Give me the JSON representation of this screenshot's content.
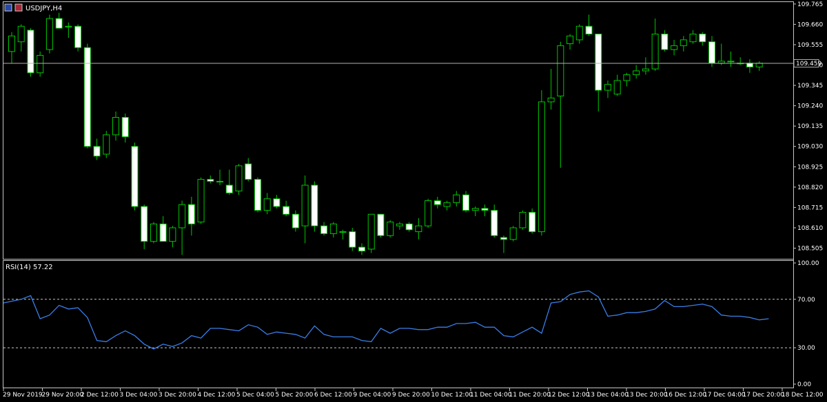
{
  "chart_data": [
    {
      "type": "candlestick",
      "title": "USDJPY,H4",
      "price_scale": [
        "109.765",
        "109.660",
        "109.555",
        "109.450",
        "109.345",
        "109.240",
        "109.135",
        "109.030",
        "108.925",
        "108.820",
        "108.715",
        "108.610",
        "108.505"
      ],
      "ylim": [
        108.45,
        109.775
      ],
      "bid_price": "109.459",
      "bid_value": 109.459,
      "candles": [
        {
          "o": 109.52,
          "h": 109.62,
          "l": 109.46,
          "c": 109.6
        },
        {
          "o": 109.57,
          "h": 109.66,
          "l": 109.52,
          "c": 109.65
        },
        {
          "o": 109.63,
          "h": 109.64,
          "l": 109.39,
          "c": 109.41
        },
        {
          "o": 109.41,
          "h": 109.52,
          "l": 109.39,
          "c": 109.5
        },
        {
          "o": 109.53,
          "h": 109.71,
          "l": 109.51,
          "c": 109.69
        },
        {
          "o": 109.69,
          "h": 109.72,
          "l": 109.64,
          "c": 109.64
        },
        {
          "o": 109.65,
          "h": 109.67,
          "l": 109.59,
          "c": 109.65
        },
        {
          "o": 109.65,
          "h": 109.66,
          "l": 109.52,
          "c": 109.54
        },
        {
          "o": 109.54,
          "h": 109.56,
          "l": 109.02,
          "c": 109.03
        },
        {
          "o": 109.03,
          "h": 109.07,
          "l": 108.96,
          "c": 108.98
        },
        {
          "o": 108.99,
          "h": 109.11,
          "l": 108.97,
          "c": 109.09
        },
        {
          "o": 109.09,
          "h": 109.21,
          "l": 109.06,
          "c": 109.18
        },
        {
          "o": 109.18,
          "h": 109.2,
          "l": 109.05,
          "c": 109.08
        },
        {
          "o": 109.03,
          "h": 109.05,
          "l": 108.7,
          "c": 108.72
        },
        {
          "o": 108.72,
          "h": 108.73,
          "l": 108.5,
          "c": 108.54
        },
        {
          "o": 108.54,
          "h": 108.64,
          "l": 108.53,
          "c": 108.63
        },
        {
          "o": 108.63,
          "h": 108.67,
          "l": 108.54,
          "c": 108.54
        },
        {
          "o": 108.54,
          "h": 108.62,
          "l": 108.51,
          "c": 108.61
        },
        {
          "o": 108.61,
          "h": 108.75,
          "l": 108.47,
          "c": 108.73
        },
        {
          "o": 108.73,
          "h": 108.77,
          "l": 108.57,
          "c": 108.63
        },
        {
          "o": 108.64,
          "h": 108.87,
          "l": 108.63,
          "c": 108.86
        },
        {
          "o": 108.86,
          "h": 108.88,
          "l": 108.84,
          "c": 108.85
        },
        {
          "o": 108.85,
          "h": 108.91,
          "l": 108.83,
          "c": 108.85
        },
        {
          "o": 108.83,
          "h": 108.91,
          "l": 108.78,
          "c": 108.79
        },
        {
          "o": 108.8,
          "h": 108.94,
          "l": 108.78,
          "c": 108.93
        },
        {
          "o": 108.94,
          "h": 108.97,
          "l": 108.85,
          "c": 108.86
        },
        {
          "o": 108.86,
          "h": 108.87,
          "l": 108.69,
          "c": 108.7
        },
        {
          "o": 108.7,
          "h": 108.79,
          "l": 108.68,
          "c": 108.76
        },
        {
          "o": 108.76,
          "h": 108.78,
          "l": 108.71,
          "c": 108.72
        },
        {
          "o": 108.72,
          "h": 108.75,
          "l": 108.67,
          "c": 108.68
        },
        {
          "o": 108.68,
          "h": 108.7,
          "l": 108.59,
          "c": 108.61
        },
        {
          "o": 108.62,
          "h": 108.88,
          "l": 108.53,
          "c": 108.83
        },
        {
          "o": 108.83,
          "h": 108.85,
          "l": 108.59,
          "c": 108.62
        },
        {
          "o": 108.62,
          "h": 108.64,
          "l": 108.57,
          "c": 108.58
        },
        {
          "o": 108.58,
          "h": 108.64,
          "l": 108.56,
          "c": 108.63
        },
        {
          "o": 108.59,
          "h": 108.6,
          "l": 108.55,
          "c": 108.59
        },
        {
          "o": 108.59,
          "h": 108.61,
          "l": 108.49,
          "c": 108.51
        },
        {
          "o": 108.51,
          "h": 108.53,
          "l": 108.47,
          "c": 108.49
        },
        {
          "o": 108.5,
          "h": 108.68,
          "l": 108.48,
          "c": 108.68
        },
        {
          "o": 108.68,
          "h": 108.68,
          "l": 108.56,
          "c": 108.57
        },
        {
          "o": 108.57,
          "h": 108.65,
          "l": 108.56,
          "c": 108.64
        },
        {
          "o": 108.62,
          "h": 108.64,
          "l": 108.6,
          "c": 108.63
        },
        {
          "o": 108.63,
          "h": 108.64,
          "l": 108.59,
          "c": 108.6
        },
        {
          "o": 108.59,
          "h": 108.66,
          "l": 108.55,
          "c": 108.62
        },
        {
          "o": 108.62,
          "h": 108.76,
          "l": 108.61,
          "c": 108.75
        },
        {
          "o": 108.75,
          "h": 108.77,
          "l": 108.71,
          "c": 108.73
        },
        {
          "o": 108.72,
          "h": 108.75,
          "l": 108.7,
          "c": 108.74
        },
        {
          "o": 108.74,
          "h": 108.8,
          "l": 108.72,
          "c": 108.78
        },
        {
          "o": 108.78,
          "h": 108.8,
          "l": 108.69,
          "c": 108.7
        },
        {
          "o": 108.7,
          "h": 108.72,
          "l": 108.67,
          "c": 108.71
        },
        {
          "o": 108.71,
          "h": 108.73,
          "l": 108.67,
          "c": 108.7
        },
        {
          "o": 108.7,
          "h": 108.73,
          "l": 108.56,
          "c": 108.57
        },
        {
          "o": 108.56,
          "h": 108.57,
          "l": 108.48,
          "c": 108.55
        },
        {
          "o": 108.55,
          "h": 108.62,
          "l": 108.54,
          "c": 108.61
        },
        {
          "o": 108.61,
          "h": 108.7,
          "l": 108.6,
          "c": 108.69
        },
        {
          "o": 108.69,
          "h": 108.71,
          "l": 108.58,
          "c": 108.59
        },
        {
          "o": 108.59,
          "h": 109.32,
          "l": 108.57,
          "c": 109.26
        },
        {
          "o": 109.26,
          "h": 109.43,
          "l": 109.22,
          "c": 109.28
        },
        {
          "o": 109.29,
          "h": 109.57,
          "l": 108.92,
          "c": 109.55
        },
        {
          "o": 109.56,
          "h": 109.61,
          "l": 109.53,
          "c": 109.6
        },
        {
          "o": 109.58,
          "h": 109.66,
          "l": 109.56,
          "c": 109.65
        },
        {
          "o": 109.65,
          "h": 109.71,
          "l": 109.6,
          "c": 109.61
        },
        {
          "o": 109.61,
          "h": 109.61,
          "l": 109.21,
          "c": 109.32
        },
        {
          "o": 109.32,
          "h": 109.37,
          "l": 109.28,
          "c": 109.35
        },
        {
          "o": 109.3,
          "h": 109.4,
          "l": 109.29,
          "c": 109.37
        },
        {
          "o": 109.37,
          "h": 109.41,
          "l": 109.34,
          "c": 109.4
        },
        {
          "o": 109.4,
          "h": 109.45,
          "l": 109.38,
          "c": 109.42
        },
        {
          "o": 109.42,
          "h": 109.49,
          "l": 109.4,
          "c": 109.43
        },
        {
          "o": 109.43,
          "h": 109.69,
          "l": 109.42,
          "c": 109.61
        },
        {
          "o": 109.61,
          "h": 109.63,
          "l": 109.52,
          "c": 109.53
        },
        {
          "o": 109.53,
          "h": 109.58,
          "l": 109.5,
          "c": 109.55
        },
        {
          "o": 109.55,
          "h": 109.6,
          "l": 109.52,
          "c": 109.58
        },
        {
          "o": 109.57,
          "h": 109.63,
          "l": 109.56,
          "c": 109.61
        },
        {
          "o": 109.61,
          "h": 109.62,
          "l": 109.55,
          "c": 109.57
        },
        {
          "o": 109.57,
          "h": 109.6,
          "l": 109.44,
          "c": 109.46
        },
        {
          "o": 109.46,
          "h": 109.56,
          "l": 109.45,
          "c": 109.47
        },
        {
          "o": 109.47,
          "h": 109.52,
          "l": 109.44,
          "c": 109.47
        },
        {
          "o": 109.46,
          "h": 109.49,
          "l": 109.45,
          "c": 109.46
        },
        {
          "o": 109.46,
          "h": 109.48,
          "l": 109.41,
          "c": 109.44
        },
        {
          "o": 109.44,
          "h": 109.47,
          "l": 109.42,
          "c": 109.46
        }
      ],
      "time_labels": [
        "29 Nov 2019",
        "29 Nov 20:00",
        "2 Dec 12:00",
        "3 Dec 04:00",
        "3 Dec 20:00",
        "4 Dec 12:00",
        "5 Dec 04:00",
        "5 Dec 20:00",
        "6 Dec 12:00",
        "9 Dec 04:00",
        "9 Dec 20:00",
        "10 Dec 12:00",
        "11 Dec 04:00",
        "11 Dec 20:00",
        "12 Dec 12:00",
        "13 Dec 04:00",
        "13 Dec 20:00",
        "16 Dec 12:00",
        "17 Dec 04:00",
        "17 Dec 20:00",
        "18 Dec 12:00"
      ]
    },
    {
      "type": "line",
      "title": "RSI(14) 57.22",
      "scale_labels": [
        "100.00",
        "70.00",
        "30.00",
        "0.00"
      ],
      "levels": [
        70,
        30
      ],
      "ylim": [
        0,
        100
      ],
      "color": "#3a7ee8",
      "values": [
        67,
        70,
        73,
        54,
        57,
        65,
        62,
        63,
        55,
        36,
        35,
        40,
        44,
        40,
        33,
        29,
        33,
        31,
        34,
        40,
        38,
        46,
        46,
        45,
        44,
        49,
        47,
        41,
        43,
        42,
        41,
        38,
        48,
        41,
        39,
        39,
        39,
        36,
        35,
        46,
        42,
        46,
        46,
        45,
        45,
        47,
        47,
        50,
        50,
        51,
        47,
        47,
        40,
        39,
        43,
        47,
        42,
        67,
        68,
        74,
        76,
        77,
        72,
        56,
        57,
        59,
        59,
        60,
        62,
        69,
        64,
        64,
        65,
        66,
        64,
        57,
        56,
        56,
        55,
        53,
        54
      ]
    }
  ]
}
